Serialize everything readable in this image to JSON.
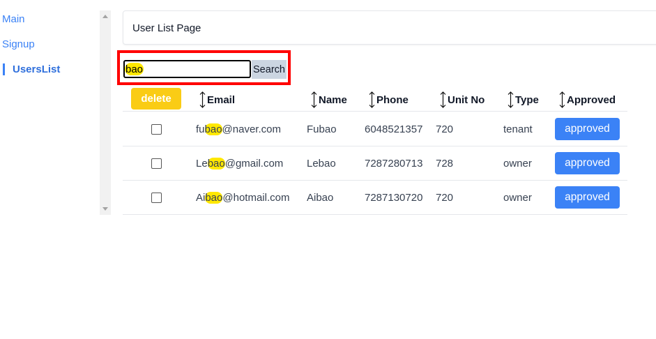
{
  "nav": {
    "items": [
      {
        "label": "Main"
      },
      {
        "label": "Signup"
      },
      {
        "label": "UsersList"
      }
    ]
  },
  "header": {
    "title": "User List Page"
  },
  "search": {
    "value": "bao",
    "button_label": "Search"
  },
  "toolbar": {
    "delete_label": "delete"
  },
  "table": {
    "columns": [
      "Email",
      "Name",
      "Phone",
      "Unit No",
      "Type",
      "Approved"
    ],
    "rows": [
      {
        "email_pre": "fu",
        "email_match": "bao",
        "email_post": "@naver.com",
        "name": "Fubao",
        "phone": "6048521357",
        "unit": "720",
        "type": "tenant",
        "approved": "approved"
      },
      {
        "email_pre": "Le",
        "email_match": "bao",
        "email_post": "@gmail.com",
        "name": "Lebao",
        "phone": "7287280713",
        "unit": "728",
        "type": "owner",
        "approved": "approved"
      },
      {
        "email_pre": "Ai",
        "email_match": "bao",
        "email_post": "@hotmail.com",
        "name": "Aibao",
        "phone": "7287130720",
        "unit": "720",
        "type": "owner",
        "approved": "approved"
      }
    ]
  },
  "colors": {
    "accent": "#3b82f6",
    "delete": "#facc15",
    "highlight": "#ffe800",
    "annotation": "#ff0000"
  }
}
